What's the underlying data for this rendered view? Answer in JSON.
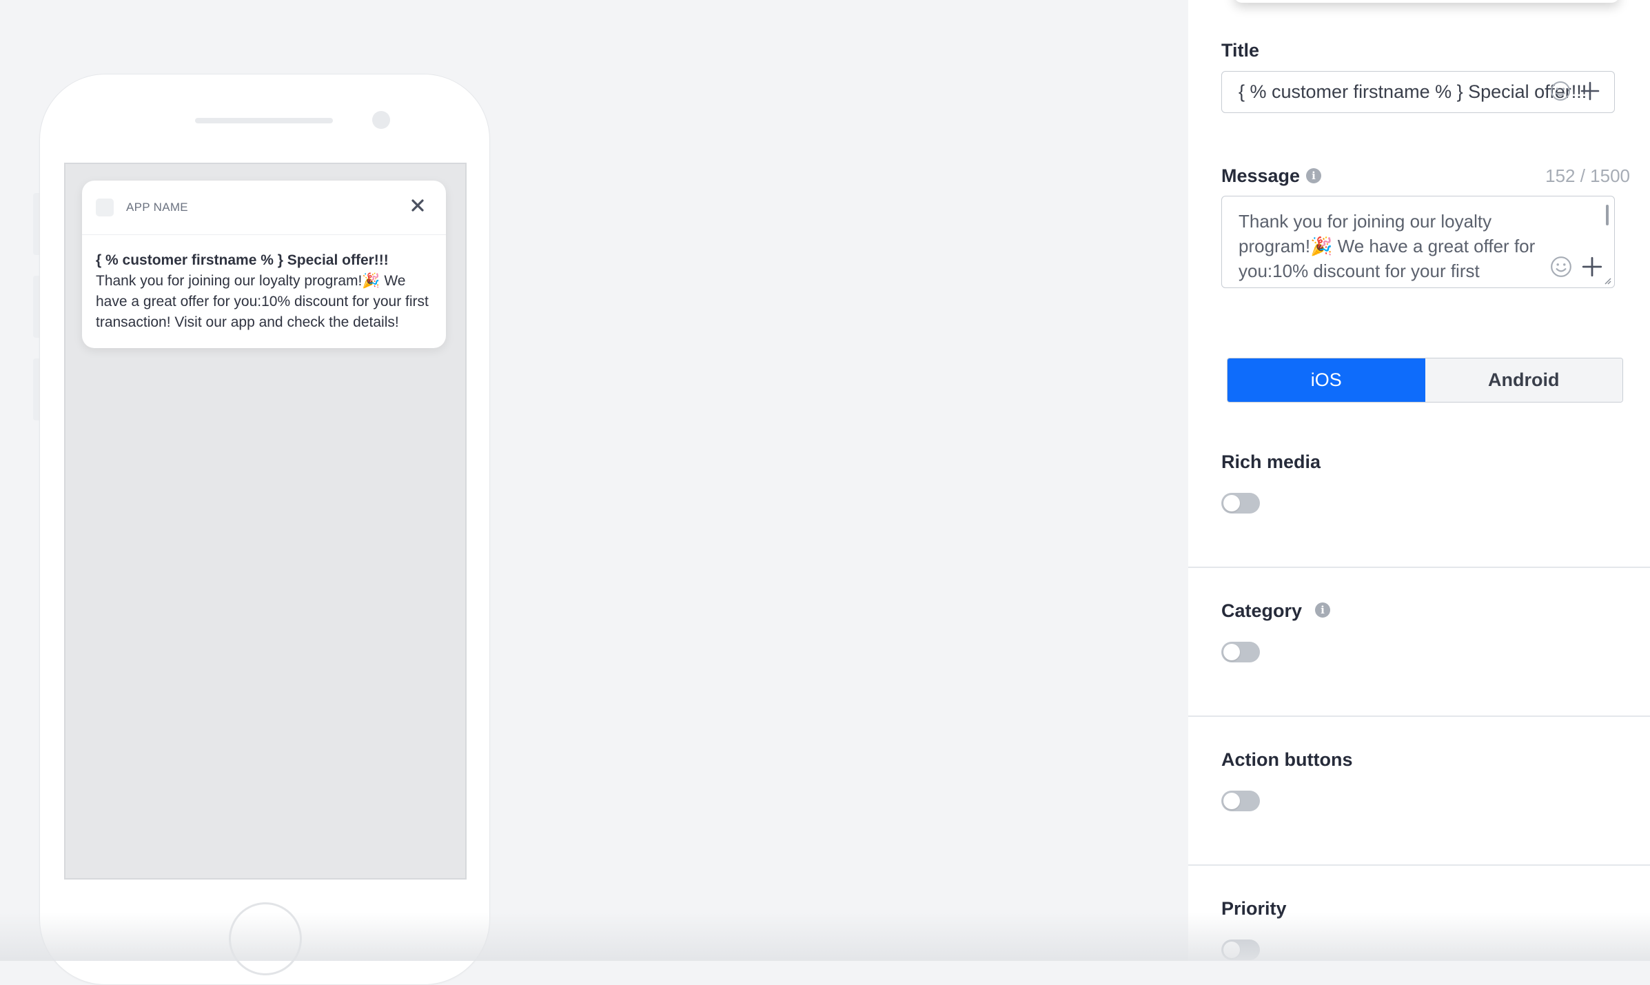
{
  "preview": {
    "app_name": "APP NAME",
    "notification_title": "{ % customer firstname % } Special offer!!!",
    "notification_message": "Thank you for joining our loyalty program!🎉 We have a great offer for you:10% discount for your first transaction! Visit our app and check the details!"
  },
  "form": {
    "title_label": "Title",
    "title_value": "{ % customer firstname % } Special offer!!!",
    "message_label": "Message",
    "message_counter": "152 / 1500",
    "message_value": "Thank you for joining our loyalty program!🎉 We have a great offer for you:10% discount for your first transaction! Visit our app and check the details!",
    "platforms": [
      {
        "label": "iOS",
        "active": true
      },
      {
        "label": "Android",
        "active": false
      }
    ],
    "sections": [
      {
        "label": "Rich media",
        "enabled": false
      },
      {
        "label": "Category",
        "enabled": false
      },
      {
        "label": "Action buttons",
        "enabled": false
      },
      {
        "label": "Priority",
        "enabled": false
      }
    ]
  },
  "colors": {
    "accent": "#0e6cfb",
    "toggle_off": "#bfc4cb",
    "page_bg": "#f3f4f6"
  }
}
